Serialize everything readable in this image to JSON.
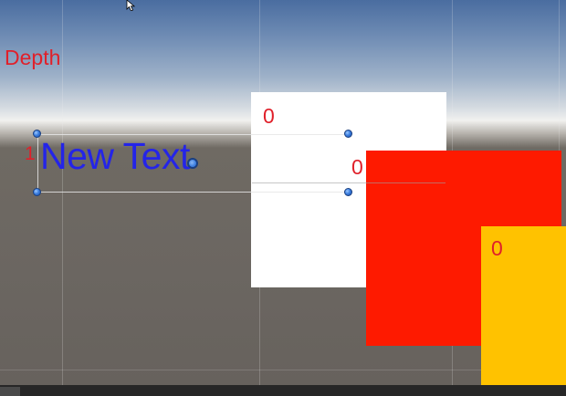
{
  "scene": {
    "depth_label": "Depth",
    "panels": [
      {
        "name": "white",
        "depth": "0",
        "color": "#ffffff"
      },
      {
        "name": "red",
        "depth": "0",
        "color": "#fe1a00"
      },
      {
        "name": "yellow",
        "depth": "0",
        "color": "#ffc200"
      }
    ],
    "text_object": {
      "text": "New Text",
      "depth": "1",
      "color": "#2424e8"
    },
    "label_color": "#e0202a",
    "handle_icon": "blue-circle-handle-icon",
    "pivot_icon": "pivot-circle-icon",
    "cursor_icon": "mouse-pointer-icon"
  }
}
